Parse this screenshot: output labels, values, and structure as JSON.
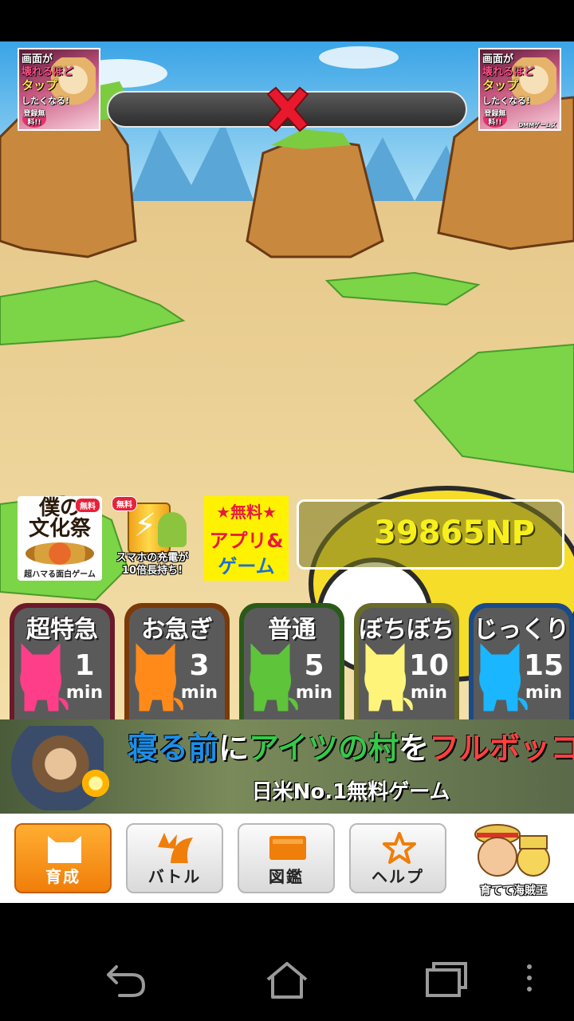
{
  "ads_top": {
    "left": {
      "line1": "画面が",
      "line2": "壊れるほど",
      "line3": "タップ",
      "line4": "したくなる!",
      "badge": "登録無料!!"
    },
    "right": {
      "line1": "画面が",
      "line2": "壊れるほど",
      "line3": "タップ",
      "line4": "したくなる!",
      "badge": "登録無料!!",
      "brand": "DMMゲームズ"
    }
  },
  "mini_ads": [
    {
      "title1": "僕の",
      "title2": "文化祭",
      "badge": "無料",
      "sub": "超ハマる面白ゲーム"
    },
    {
      "badge": "無料",
      "sub1": "スマホの充電が",
      "sub2": "10倍長持ち!"
    },
    {
      "line1": "★無料★",
      "line2": "アプリ&",
      "line3": "ゲーム"
    }
  ],
  "np_value": "39865NP",
  "speeds": [
    {
      "label": "超特急",
      "num": "1",
      "unit": "min",
      "color": "#ff3e8a",
      "frame": "#6a1a2a"
    },
    {
      "label": "お急ぎ",
      "num": "3",
      "unit": "min",
      "color": "#ff8a1a",
      "frame": "#7a3a0a"
    },
    {
      "label": "普通",
      "num": "5",
      "unit": "min",
      "color": "#5ec43a",
      "frame": "#2a5a1a"
    },
    {
      "label": "ぼちぼち",
      "num": "10",
      "unit": "min",
      "color": "#fff47a",
      "frame": "#6a6a2a"
    },
    {
      "label": "じっくり",
      "num": "15",
      "unit": "min",
      "color": "#1ab6ff",
      "frame": "#1a4a8a"
    }
  ],
  "banner": {
    "p1": "寝る前",
    "p2": "に",
    "p3": "アイツの村",
    "p4": "を",
    "p5": "フルボッコ",
    "sub": "日米No.1無料ゲーム"
  },
  "tabs": [
    {
      "label": "育成",
      "icon": "cat-icon",
      "active": true
    },
    {
      "label": "バトル",
      "icon": "battle-icon",
      "active": false
    },
    {
      "label": "図鑑",
      "icon": "book-icon",
      "active": false
    },
    {
      "label": "ヘルプ",
      "icon": "star-icon",
      "active": false
    }
  ],
  "pirate_ad": {
    "label": "育てて海賊王"
  },
  "colors": {
    "accent": "#f5900f",
    "np": "#f7f01c",
    "close": "#e8192c"
  }
}
